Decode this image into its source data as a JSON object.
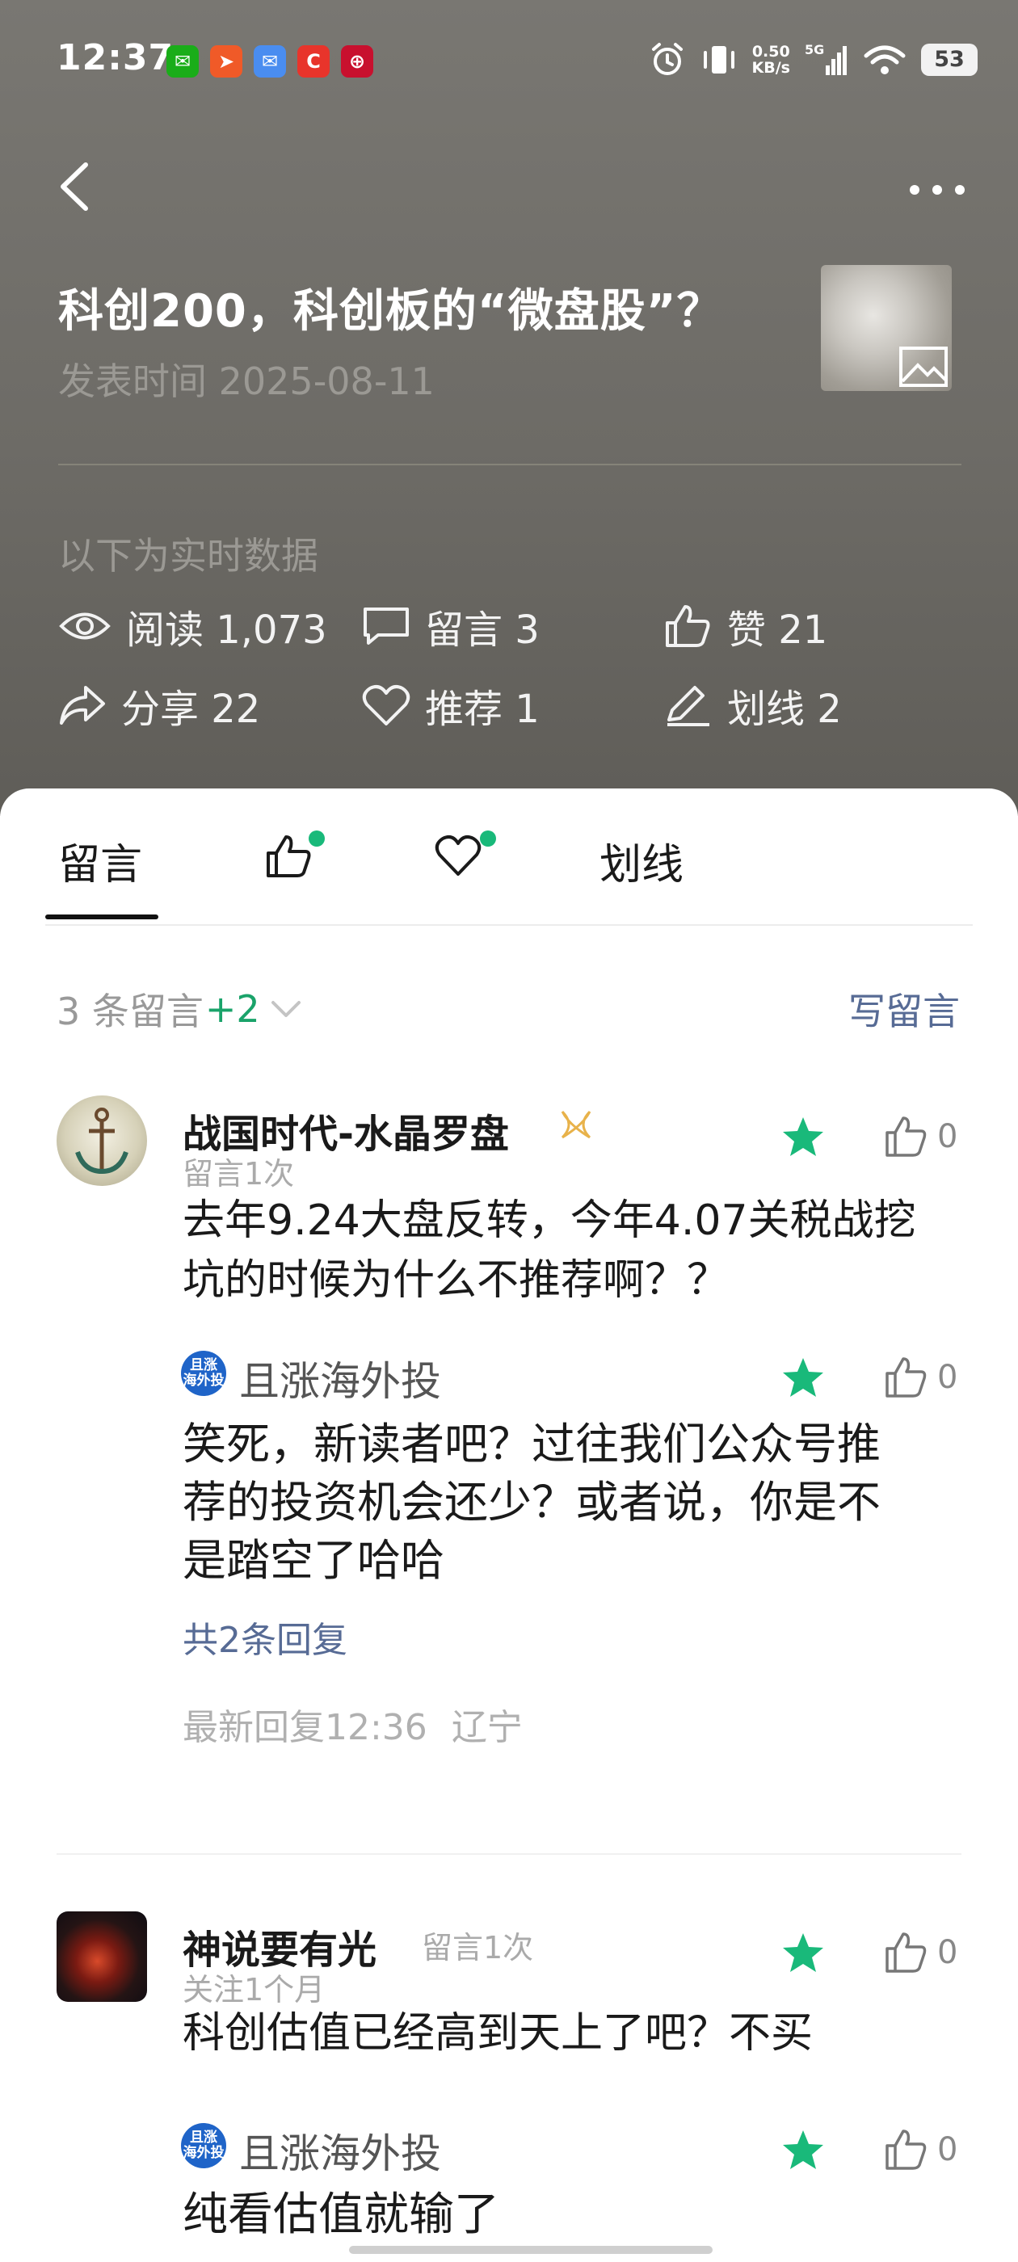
{
  "status_bar": {
    "time": "12:37",
    "app_icons": [
      {
        "name": "wechat-icon",
        "glyph": "💬",
        "color": "#1aad19"
      },
      {
        "name": "feishu-icon",
        "glyph": "✈",
        "color": "#f05a28"
      },
      {
        "name": "mail-icon",
        "glyph": "✉",
        "color": "#4a8df0"
      },
      {
        "name": "c-app-icon",
        "glyph": "C",
        "color": "#e8342b"
      },
      {
        "name": "bank-icon",
        "glyph": "⊕",
        "color": "#c8102e"
      }
    ],
    "net_speed_value": "0.50",
    "net_speed_unit": "KB/s",
    "signal_label": "5G",
    "battery": "53"
  },
  "article": {
    "title": "科创200，科创板的“微盘股”？",
    "date": "发表时间 2025-08-11"
  },
  "stats": {
    "realtime_label": "以下为实时数据",
    "read": "阅读 1,073",
    "comments": "留言 3",
    "likes": "赞 21",
    "share": "分享 22",
    "recommend": "推荐 1",
    "highlight": "划线 2"
  },
  "tabs": {
    "comments": "留言",
    "highlight": "划线"
  },
  "comment_summary": {
    "count": "3 条留言",
    "plus": "+2",
    "write_button": "写留言"
  },
  "comments": [
    {
      "name": "战国时代-水晶罗盘",
      "sub": "留言1次",
      "text_line1": "去年9.24大盘反转，今年4.07关税战挖",
      "text_line2": "坑的时候为什么不推荐啊？？",
      "like_count": "0",
      "reply": {
        "author": "且涨海外投",
        "badge": "且涨\n海外投",
        "text_line1": "笑死，新读者吧？过往我们公众号推",
        "text_line2": "荐的投资机会还少？或者说，你是不",
        "text_line3": "是踏空了哈哈",
        "like_count": "0"
      },
      "reply_count": "共2条回复",
      "latest_reply_time": "最新回复12:36",
      "latest_reply_location": "辽宁"
    },
    {
      "name": "神说要有光",
      "badge": "留言1次",
      "sub": "关注1个月",
      "text_line1": "科创估值已经高到天上了吧？不买",
      "like_count": "0",
      "reply": {
        "author": "且涨海外投",
        "text_line1": "纯看估值就输了",
        "like_count": "0"
      }
    }
  ],
  "colors": {
    "header_bg": "#6f6d68",
    "accent_green": "#19b97a",
    "link_blue": "#576b95",
    "plus_green": "#1aa36a"
  }
}
